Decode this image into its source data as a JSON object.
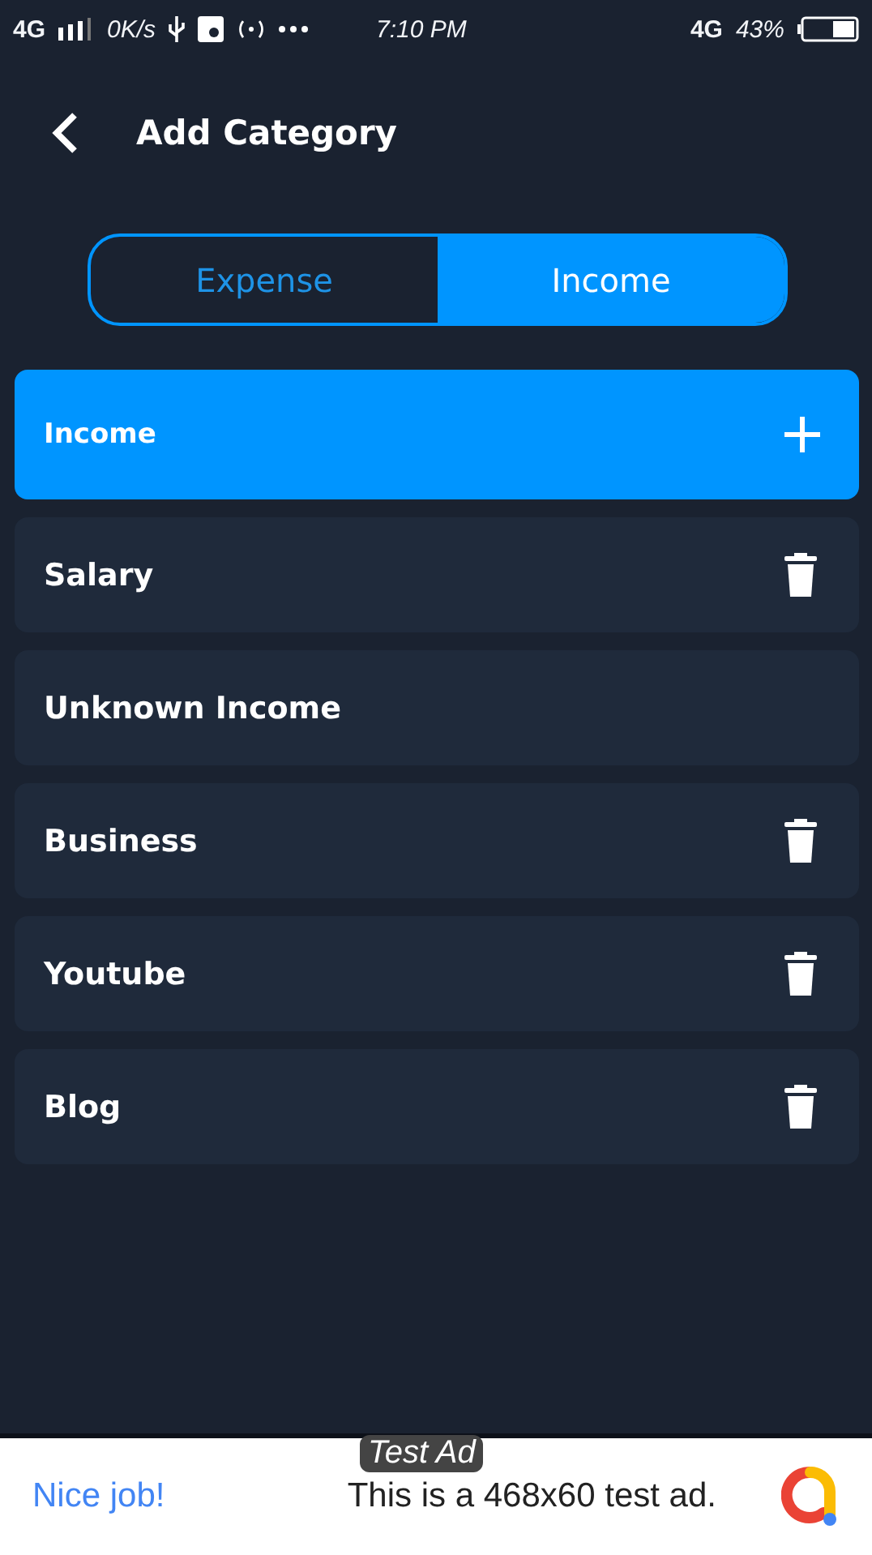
{
  "status_bar": {
    "network": "4G",
    "speed": "0K/s",
    "time": "7:10 PM",
    "data_network": "4G",
    "battery": "43%"
  },
  "header": {
    "title": "Add Category"
  },
  "tabs": [
    {
      "label": "Expense",
      "selected": false
    },
    {
      "label": "Income",
      "selected": true
    }
  ],
  "add_row": {
    "label": "Income"
  },
  "categories": [
    {
      "name": "Salary",
      "deletable": true
    },
    {
      "name": "Unknown Income",
      "deletable": false
    },
    {
      "name": "Business",
      "deletable": true
    },
    {
      "name": "Youtube",
      "deletable": true
    },
    {
      "name": "Blog",
      "deletable": true
    }
  ],
  "ad": {
    "badge": "Test Ad",
    "headline": "Nice job!",
    "text": "This is a 468x60 test ad."
  }
}
